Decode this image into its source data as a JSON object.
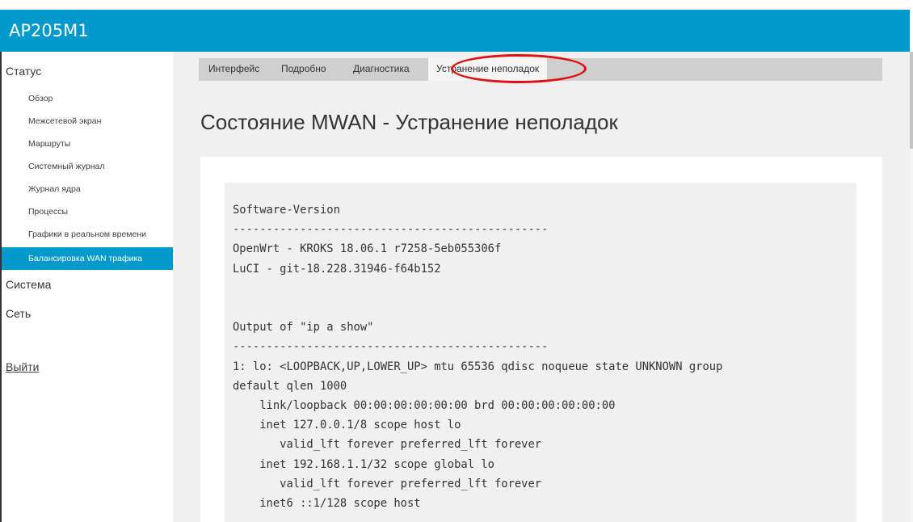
{
  "app": {
    "title": "AP205M1"
  },
  "sidebar": {
    "status_label": "Статус",
    "status_items": [
      "Обзор",
      "Межсетевой экран",
      "Маршруты",
      "Системный журнал",
      "Журнал ядра",
      "Процессы",
      "Графики в реальном времени",
      "Балансировка WAN трафика"
    ],
    "system_label": "Система",
    "network_label": "Сеть",
    "logout_label": "Выйти"
  },
  "tabs": [
    "Интерфейс",
    "Подробно",
    "Диагностика",
    "Устранение неполадок"
  ],
  "colors": {
    "accent": "#0099cc",
    "highlight": "#e01010"
  },
  "page": {
    "title": "Состояние MWAN - Устранение неполадок"
  },
  "output": {
    "lines": [
      "Software-Version",
      "-----------------------------------------------",
      "OpenWrt - KROKS 18.06.1 r7258-5eb055306f",
      "LuCI - git-18.228.31946-f64b152",
      "",
      "",
      "Output of \"ip a show\"",
      "-----------------------------------------------",
      "1: lo: <LOOPBACK,UP,LOWER_UP> mtu 65536 qdisc noqueue state UNKNOWN group",
      "default qlen 1000",
      "    link/loopback 00:00:00:00:00:00 brd 00:00:00:00:00:00",
      "    inet 127.0.0.1/8 scope host lo",
      "       valid_lft forever preferred_lft forever",
      "    inet 192.168.1.1/32 scope global lo",
      "       valid_lft forever preferred_lft forever",
      "    inet6 ::1/128 scope host"
    ]
  }
}
